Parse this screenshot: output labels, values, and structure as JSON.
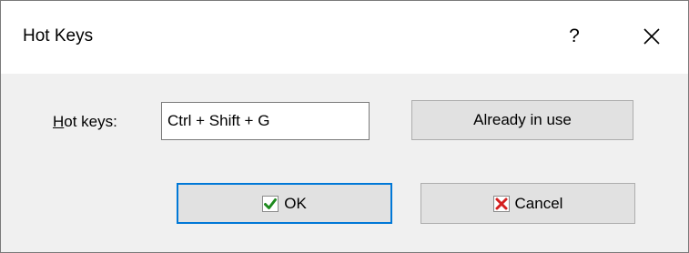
{
  "dialog": {
    "title": "Hot Keys",
    "help_label": "?",
    "close_icon": "close-icon"
  },
  "form": {
    "hotkeys_label_mnemonic": "H",
    "hotkeys_label_rest": "ot keys:",
    "hotkeys_value": "Ctrl + Shift + G"
  },
  "buttons": {
    "already_in_use_label": "Already in use",
    "ok_label": "OK",
    "ok_icon": "checkmark-icon",
    "cancel_label": "Cancel",
    "cancel_icon": "x-mark-icon"
  },
  "colors": {
    "ok_check_green": "#1e8a1e",
    "cancel_x_red": "#d42020",
    "focus_blue": "#0078d7"
  }
}
